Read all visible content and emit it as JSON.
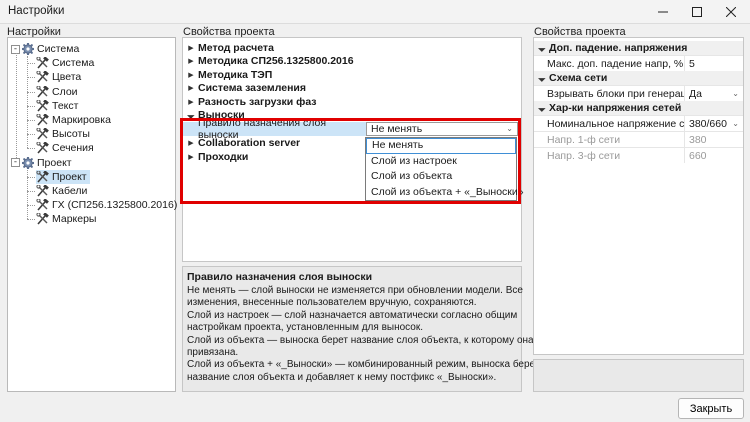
{
  "window": {
    "title": "Настройки"
  },
  "left": {
    "label": "Настройки",
    "tree": [
      {
        "label": "Система",
        "level": 0,
        "icon": "gear-icon",
        "toggle": "-"
      },
      {
        "label": "Система",
        "level": 1,
        "icon": "tools-icon"
      },
      {
        "label": "Цвета",
        "level": 1,
        "icon": "tools-icon"
      },
      {
        "label": "Слои",
        "level": 1,
        "icon": "tools-icon"
      },
      {
        "label": "Текст",
        "level": 1,
        "icon": "tools-icon"
      },
      {
        "label": "Маркировка",
        "level": 1,
        "icon": "tools-icon"
      },
      {
        "label": "Высоты",
        "level": 1,
        "icon": "tools-icon"
      },
      {
        "label": "Сечения",
        "level": 1,
        "icon": "tools-icon"
      },
      {
        "label": "Проект",
        "level": 0,
        "icon": "gear-icon",
        "toggle": "-"
      },
      {
        "label": "Проект",
        "level": 1,
        "icon": "tools-icon",
        "selected": true
      },
      {
        "label": "Кабели",
        "level": 1,
        "icon": "tools-icon"
      },
      {
        "label": "ГХ (СП256.1325800.2016)",
        "level": 1,
        "icon": "tools-icon"
      },
      {
        "label": "Маркеры",
        "level": 1,
        "icon": "tools-icon"
      }
    ]
  },
  "middle": {
    "label": "Свойства проекта",
    "categories_top": [
      "Метод расчета",
      "Методика СП256.1325800.2016",
      "Методика ТЭП",
      "Система заземления",
      "Разность загрузки фаз"
    ],
    "expanded_category": "Выноски",
    "property": {
      "name": "Правило назначения слоя выноски",
      "value": "Не менять"
    },
    "categories_bottom": [
      "Collaboration server",
      "Проходки"
    ],
    "dropdown_options": [
      "Не менять",
      "Слой из настроек",
      "Слой из объекта",
      "Слой из объекта + «_Выноски»"
    ],
    "description": {
      "title": "Правило назначения слоя выноски",
      "lines": [
        "Не менять — слой выноски не изменяется при обновлении модели. Все",
        "изменения, внесенные пользователем вручную, сохраняются.",
        "Слой из настроек — слой назначается автоматически согласно общим",
        "настройкам проекта, установленным для выносок.",
        "Слой из объекта — выноска берет название слоя объекта, к которому она",
        "привязана.",
        "Слой из объекта + «_Выноски» — комбинированный режим, выноска берет",
        "название слоя объекта и добавляет к нему постфикс «_Выноски»."
      ]
    }
  },
  "right": {
    "label": "Свойства проекта",
    "groups": [
      {
        "name": "Доп. падение. напряжения",
        "rows": [
          {
            "key": "Макс. доп. падение напр, %",
            "value": "5"
          }
        ]
      },
      {
        "name": "Схема сети",
        "rows": [
          {
            "key": "Взрывать блоки при генерации",
            "value": "Да",
            "dropdown": true
          }
        ]
      },
      {
        "name": "Хар-ки напряжения сетей",
        "rows": [
          {
            "key": "Номинальное напряжение сети",
            "value": "380/660",
            "dropdown": true
          },
          {
            "key": "Напр. 1-ф сети",
            "value": "380",
            "disabled": true
          },
          {
            "key": "Напр. 3-ф сети",
            "value": "660",
            "disabled": true
          }
        ]
      }
    ]
  },
  "footer": {
    "close_label": "Закрыть"
  }
}
